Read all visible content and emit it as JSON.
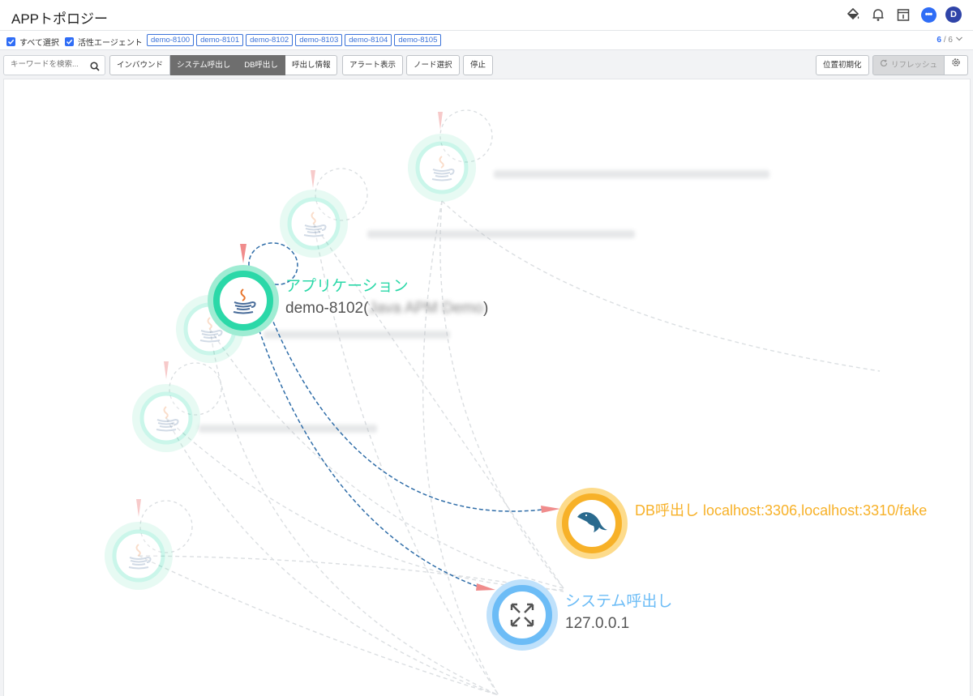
{
  "header": {
    "title": "APPトポロジー",
    "avatar_initial": "D",
    "chat_glyph": "•••",
    "icons": [
      "paint-bucket-icon",
      "bell-icon",
      "calendar-icon",
      "chat-icon"
    ]
  },
  "filters": {
    "select_all_label": "すべて選択",
    "active_agent_label": "活性エージェント",
    "agents": [
      "demo-8100",
      "demo-8101",
      "demo-8102",
      "demo-8103",
      "demo-8104",
      "demo-8105"
    ],
    "page_current": "6",
    "page_total": "/ 6"
  },
  "toolbar": {
    "search_placeholder": "キーワードを検索...",
    "modes": [
      "インバウンド",
      "システム呼出し",
      "DB呼出し",
      "呼出し情報"
    ],
    "active_modes": [
      1,
      2
    ],
    "alert_label": "アラート表示",
    "node_select_label": "ノード選択",
    "stop_label": "停止",
    "reset_position_label": "位置初期化",
    "refresh_label": "リフレッシュ"
  },
  "topology": {
    "selected_app": {
      "category": "アプリケーション",
      "name_prefix": "demo-8102(",
      "name_blurred": "Java APM Demo",
      "name_suffix": ")"
    },
    "db_node": {
      "label": "DB呼出し localhost:3306,localhost:3310/fake"
    },
    "system_node": {
      "category": "システム呼出し",
      "address": "127.0.0.1"
    },
    "colors": {
      "app": "#2bd8a8",
      "db": "#f7b128",
      "system": "#6cbcf6",
      "edge": "#2f6da8",
      "arrow": "#f08c8c"
    }
  }
}
